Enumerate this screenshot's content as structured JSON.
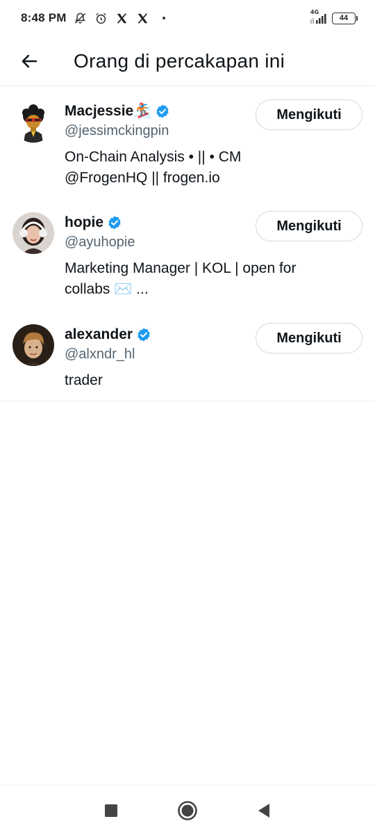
{
  "status_bar": {
    "time": "8:48 PM",
    "network": "4G",
    "battery": "44",
    "icons": [
      "bell-off-icon",
      "alarm-icon",
      "x-logo-icon",
      "x-logo-icon",
      "dot-icon",
      "signal-icon",
      "battery-icon"
    ]
  },
  "header": {
    "title": "Orang di percakapan ini",
    "back_icon": "arrow-left-icon"
  },
  "people": [
    {
      "name": "Macjessie🏂",
      "handle": "@jessimckingpin",
      "bio": "On-Chain Analysis • || • CM  @FrogenHQ || frogen.io",
      "follow_label": "Mengikuti",
      "verified": true
    },
    {
      "name": "hopie",
      "handle": "@ayuhopie",
      "bio": "Marketing Manager | KOL | open for collabs ✉️ ...",
      "follow_label": "Mengikuti",
      "verified": true
    },
    {
      "name": "alexander",
      "handle": "@alxndr_hl",
      "bio": "trader",
      "follow_label": "Mengikuti",
      "verified": true
    }
  ],
  "nav_bar": {
    "icons": [
      "recents-square-icon",
      "home-circle-icon",
      "back-triangle-icon"
    ]
  },
  "colors": {
    "verified": "#1d9bf0",
    "secondary_text": "#536471",
    "border": "#cfd9de"
  }
}
